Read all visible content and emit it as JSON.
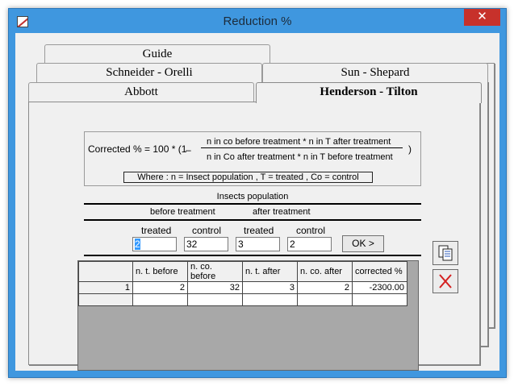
{
  "window": {
    "title": "Reduction %",
    "close_glyph": "✕",
    "icon": "app-chart-icon"
  },
  "tabs": {
    "row1": [
      "Guide"
    ],
    "row2": [
      "Schneider - Orelli",
      "Sun - Shepard"
    ],
    "row3": [
      "Abbott",
      "Henderson - Tilton"
    ],
    "active": "Henderson - Tilton"
  },
  "formula": {
    "lhs": "Corrected % = 100 * (1",
    "minus": "–",
    "numerator": "n  in co before treatment *  n  in T after treatment",
    "denominator": "n  in Co after treatment *  n  in T before treatment",
    "close": ")",
    "where": "Where :    n = Insect population ,    T = treated ,     Co = control"
  },
  "section": {
    "title": "Insects population",
    "before": "before treatment",
    "after": "after treatment"
  },
  "inputs": {
    "labels": [
      "treated",
      "control",
      "treated",
      "control"
    ],
    "values": [
      "2",
      "32",
      "3",
      "2"
    ],
    "ok_label": "OK >"
  },
  "table": {
    "headers": [
      "",
      "n. t. before",
      "n. co. before",
      "n. t. after",
      "n. co. after",
      "corrected %"
    ],
    "rows": [
      [
        "1",
        "2",
        "32",
        "3",
        "2",
        "-2300.00"
      ],
      [
        "",
        "",
        "",
        "",
        "",
        ""
      ]
    ]
  },
  "side_buttons": {
    "copy_icon": "copy-icon",
    "delete_icon": "delete-icon",
    "accent": "#d42020"
  }
}
